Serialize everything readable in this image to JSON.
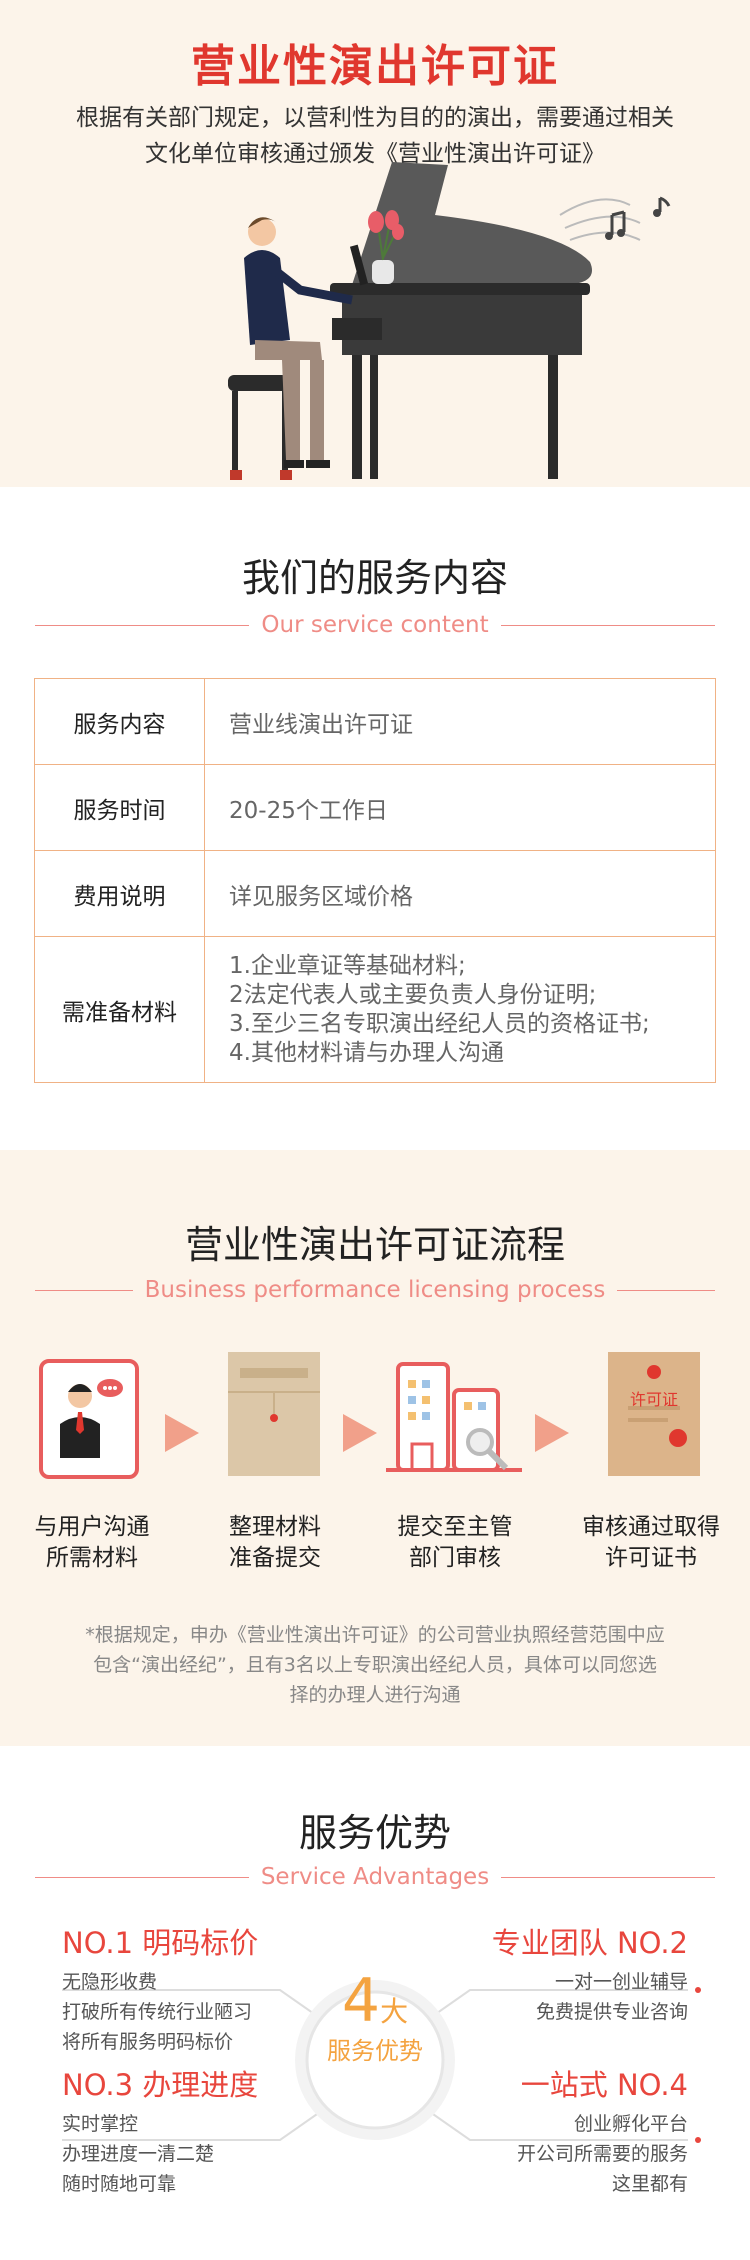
{
  "hero": {
    "title": "营业性演出许可证",
    "desc_line1": "根据有关部门规定，以营利性为目的的演出，需要通过相关",
    "desc_line2": "文化单位审核通过颁发《营业性演出许可证》"
  },
  "service": {
    "title": "我们的服务内容",
    "subtitle": "Our service content",
    "rows": [
      {
        "key": "服务内容",
        "value": "营业线演出许可证"
      },
      {
        "key": "服务时间",
        "value": "20-25个工作日"
      },
      {
        "key": "费用说明",
        "value": "详见服务区域价格"
      }
    ],
    "materials_key": "需准备材料",
    "materials": [
      "1.企业章证等基础材料;",
      "2法定代表人或主要负责人身份证明;",
      "3.至少三名专职演出经纪人员的资格证书;",
      "4.其他材料请与办理人沟通"
    ]
  },
  "process": {
    "title": "营业性演出许可证流程",
    "subtitle": "Business performance licensing process",
    "steps": [
      {
        "line1": "与用户沟通",
        "line2": "所需材料",
        "icon": "user-chat-icon"
      },
      {
        "line1": "整理材料",
        "line2": "准备提交",
        "icon": "envelope-icon"
      },
      {
        "line1": "提交至主管",
        "line2": "部门审核",
        "icon": "building-search-icon"
      },
      {
        "line1": "审核通过取得",
        "line2": "许可证书",
        "icon": "certificate-icon"
      }
    ],
    "certificate_text": "许可证",
    "note_line1": "*根据规定，申办《营业性演出许可证》的公司营业执照经营范围中应",
    "note_line2": "包含“演出经纪”，且有3名以上专职演出经纪人员，具体可以同您选",
    "note_line3": "择的办理人进行沟通"
  },
  "advantages": {
    "title": "服务优势",
    "subtitle": "Service Advantages",
    "center_num": "4",
    "center_big": "大",
    "center_text": "服务优势",
    "items": [
      {
        "head": "NO.1 明码标价",
        "lines": [
          "无隐形收费",
          "打破所有传统行业陋习",
          "将所有服务明码标价"
        ]
      },
      {
        "head": "专业团队 NO.2",
        "lines": [
          "一对一创业辅导",
          "免费提供专业咨询"
        ]
      },
      {
        "head": "NO.3 办理进度",
        "lines": [
          "实时掌控",
          "办理进度一清二楚",
          "随时随地可靠"
        ]
      },
      {
        "head": "一站式 NO.4",
        "lines": [
          "创业孵化平台",
          "开公司所需要的服务",
          "这里都有"
        ]
      }
    ]
  },
  "colors": {
    "accent_red": "#e0372e",
    "salmon": "#ef8c86",
    "cream": "#fcf4ea",
    "table_border": "#f0b285",
    "orange": "#f4a340"
  }
}
